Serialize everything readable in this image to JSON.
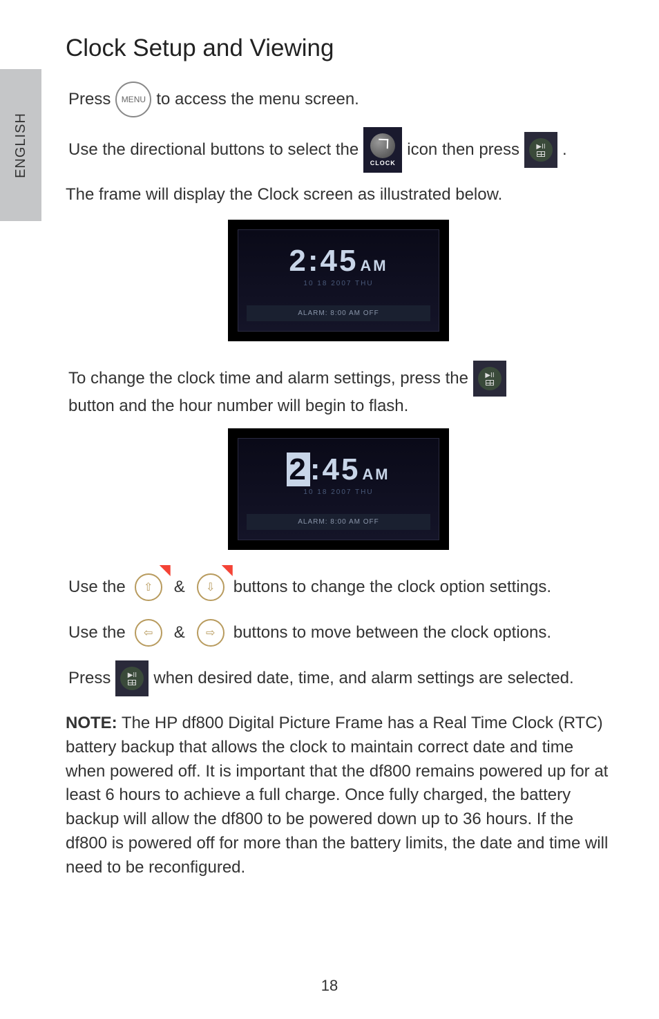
{
  "sideTab": "ENGLISH",
  "title": "Clock Setup and Viewing",
  "line1": {
    "pre": "Press ",
    "menuLabel": "MENU",
    "post": " to access the menu screen."
  },
  "line2": {
    "pre": "Use the directional buttons to select the ",
    "clockLabel": "CLOCK",
    "mid": " icon then press ",
    "post": "."
  },
  "line3": "The frame will display the Clock screen as illustrated below.",
  "clockShot1": {
    "time": "2:45",
    "ampm": "AM",
    "date": "10 18 2007 THU",
    "alarm": "ALARM:  8:00 AM  OFF"
  },
  "line4": {
    "pre": "To change the clock time and alarm settings, press the ",
    "post": " button and the hour number will begin to flash."
  },
  "clockShot2": {
    "timeHL": "2",
    "timeRest": ":45",
    "ampm": "AM",
    "date": "10 18 2007 THU",
    "alarm": "ALARM:  8:00 AM  OFF"
  },
  "line5": {
    "pre": "Use the ",
    "post": " buttons to change the clock option settings."
  },
  "line6": {
    "pre": "Use the ",
    "post": " buttons to move between the clock options."
  },
  "line7": {
    "pre": "Press ",
    "post": " when desired date, time, and alarm settings are selected."
  },
  "note": {
    "label": "NOTE:",
    "text": " The HP df800 Digital Picture Frame has a Real Time Clock (RTC) battery backup that allows the clock to maintain correct date and time when powered off.  It is important that the df800 remains powered up for at least 6 hours to achieve a full charge.  Once fully charged, the battery backup will allow the df800 to be powered down up to 36 hours.  If the df800 is powered off for more than the battery limits, the date and time will need to be reconfigured."
  },
  "pageNum": "18",
  "arrows": {
    "up": "⇧",
    "down": "⇩",
    "left": "⇦",
    "right": "⇨"
  }
}
